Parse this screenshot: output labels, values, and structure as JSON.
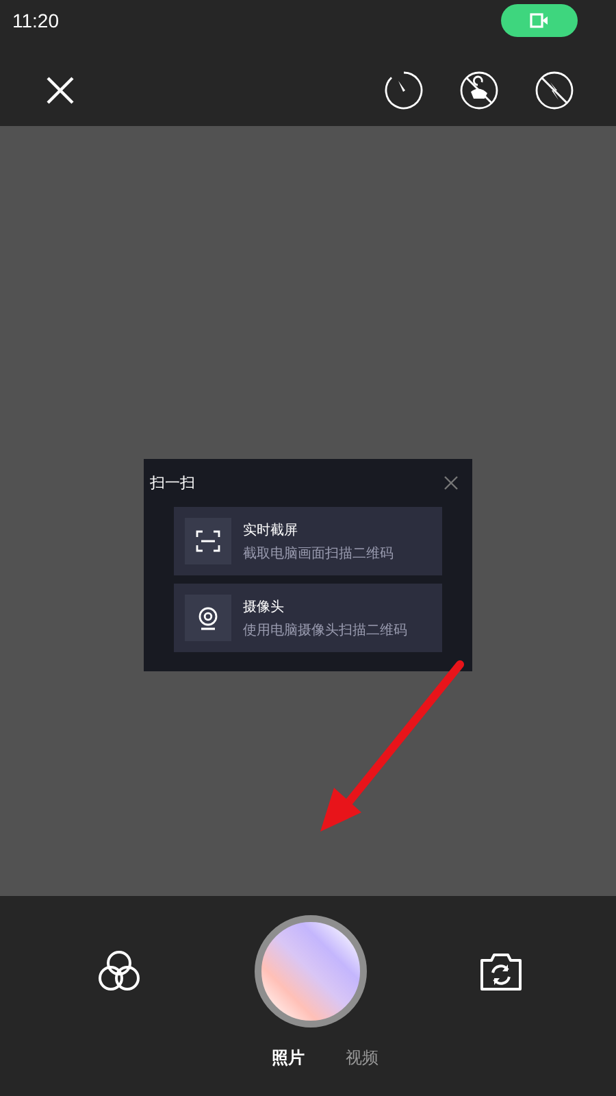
{
  "status_bar": {
    "time": "11:20"
  },
  "preview": {
    "dialog": {
      "title": "扫一扫",
      "options": [
        {
          "kind": "screen",
          "title": "实时截屏",
          "subtitle": "截取电脑画面扫描二维码"
        },
        {
          "kind": "camera",
          "title": "摄像头",
          "subtitle": "使用电脑摄像头扫描二维码"
        }
      ]
    }
  },
  "modes": [
    {
      "label": "照片",
      "selected": true
    },
    {
      "label": "视频",
      "selected": false
    }
  ]
}
